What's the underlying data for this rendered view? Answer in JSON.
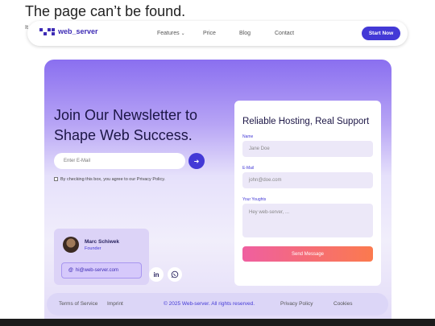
{
  "error": {
    "title": "The page can’t be found.",
    "small": "It"
  },
  "nav": {
    "brand": "web_server",
    "links": [
      "Features",
      "Price",
      "Blog",
      "Contact"
    ],
    "cta": "Start Now"
  },
  "hero": {
    "title": "Join Our Newsletter to Shape Web Success.",
    "email_placeholder": "Enter E-Mail",
    "email_button": "➜",
    "privacy_text": "By checking this box, you agree to our Privacy Policy."
  },
  "contact": {
    "name": "Marc Schiwek",
    "role": "Founder",
    "email": "hi@web-server.com"
  },
  "form": {
    "title": "Reliable Hosting, Real Support",
    "name_label": "Name",
    "name_placeholder": "Jane Doe",
    "email_label": "E-Mail",
    "email_placeholder": "john@doe.com",
    "thoughts_label": "Your Youghts",
    "thoughts_placeholder": "Hey web-server, ...",
    "submit": "Send Message"
  },
  "footer": {
    "terms": "Terms of Service",
    "imprint": "Imprint",
    "copyright": "© 2025 Web-server. All rights reserved.",
    "privacy": "Privacy Policy",
    "cookies": "Cookies"
  },
  "colors": {
    "accent": "#4339d6",
    "brand": "#3d2bb5",
    "gradient_start": "#ef5fa0",
    "gradient_end": "#fb7a4e"
  }
}
